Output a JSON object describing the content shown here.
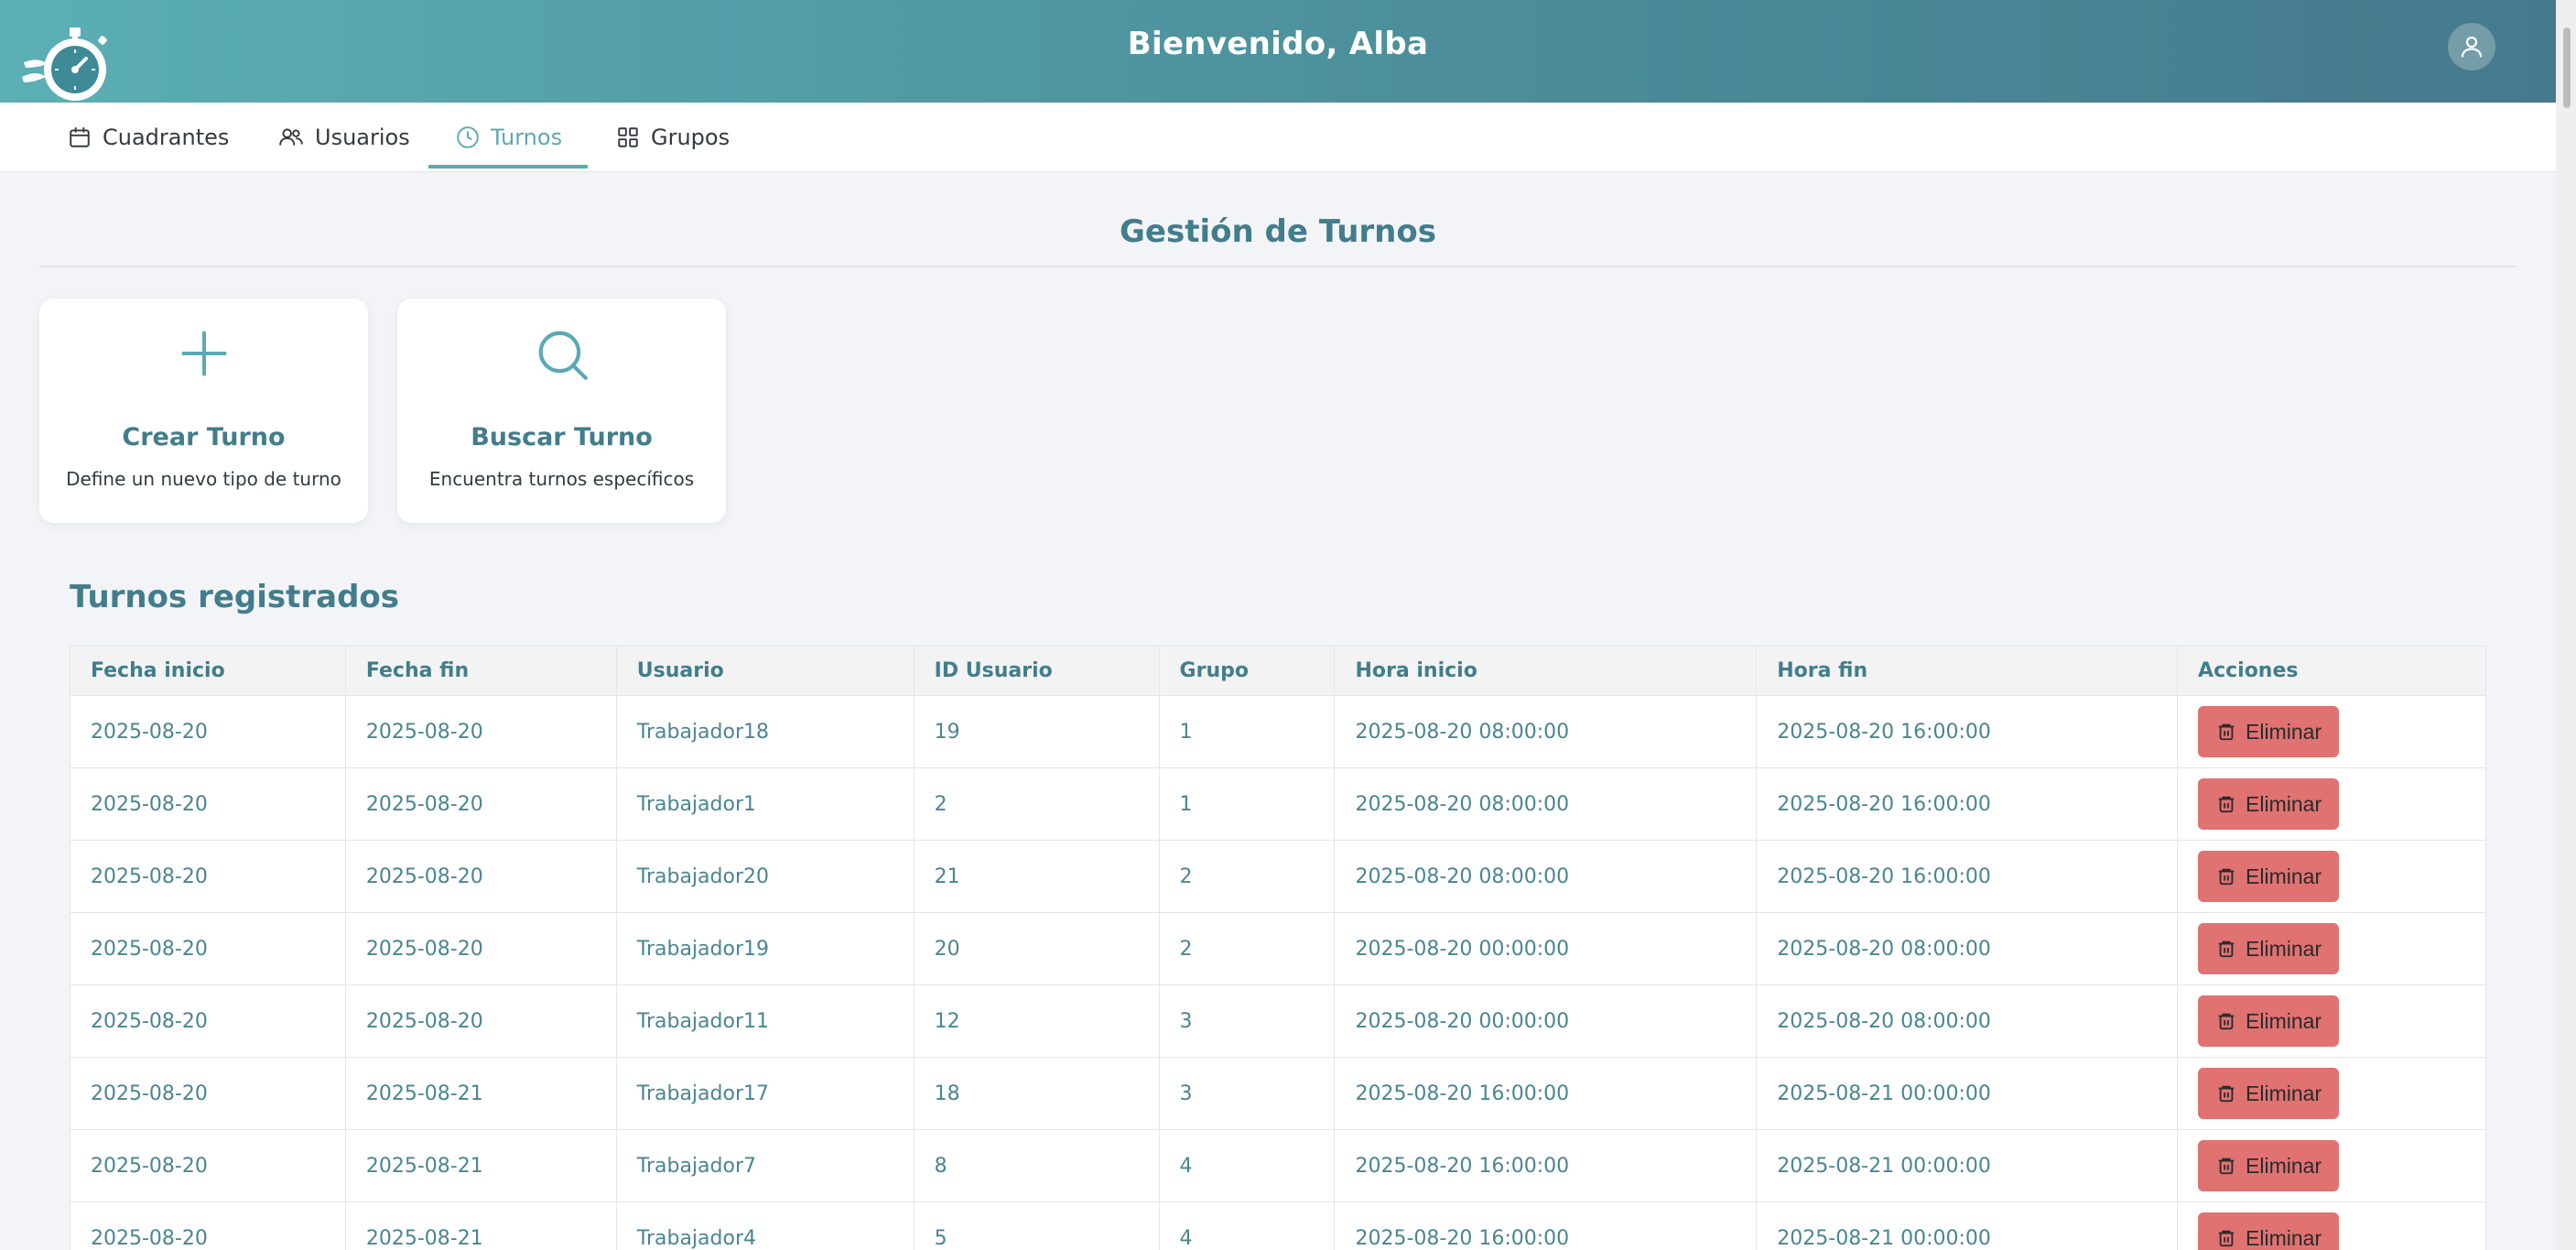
{
  "header": {
    "title": "Bienvenido, Alba",
    "logo_icon": "stopwatch-logo-icon",
    "user_icon": "user-icon"
  },
  "nav": {
    "tabs": [
      {
        "label": "Cuadrantes",
        "icon": "calendar-icon",
        "active": false
      },
      {
        "label": "Usuarios",
        "icon": "users-icon",
        "active": false
      },
      {
        "label": "Turnos",
        "icon": "clock-icon",
        "active": true
      },
      {
        "label": "Grupos",
        "icon": "grid-icon",
        "active": false
      }
    ]
  },
  "page": {
    "title": "Gestión de Turnos"
  },
  "cards": [
    {
      "title": "Crear Turno",
      "description": "Define un nuevo tipo de turno",
      "icon": "plus-icon"
    },
    {
      "title": "Buscar Turno",
      "description": "Encuentra turnos específicos",
      "icon": "search-icon"
    }
  ],
  "table": {
    "section_title": "Turnos registrados",
    "headers": [
      "Fecha inicio",
      "Fecha fin",
      "Usuario",
      "ID Usuario",
      "Grupo",
      "Hora inicio",
      "Hora fin",
      "Acciones"
    ],
    "delete_label": "Eliminar",
    "rows": [
      [
        "2025-08-20",
        "2025-08-20",
        "Trabajador18",
        "19",
        "1",
        "2025-08-20 08:00:00",
        "2025-08-20 16:00:00"
      ],
      [
        "2025-08-20",
        "2025-08-20",
        "Trabajador1",
        "2",
        "1",
        "2025-08-20 08:00:00",
        "2025-08-20 16:00:00"
      ],
      [
        "2025-08-20",
        "2025-08-20",
        "Trabajador20",
        "21",
        "2",
        "2025-08-20 08:00:00",
        "2025-08-20 16:00:00"
      ],
      [
        "2025-08-20",
        "2025-08-20",
        "Trabajador19",
        "20",
        "2",
        "2025-08-20 00:00:00",
        "2025-08-20 08:00:00"
      ],
      [
        "2025-08-20",
        "2025-08-20",
        "Trabajador11",
        "12",
        "3",
        "2025-08-20 00:00:00",
        "2025-08-20 08:00:00"
      ],
      [
        "2025-08-20",
        "2025-08-21",
        "Trabajador17",
        "18",
        "3",
        "2025-08-20 16:00:00",
        "2025-08-21 00:00:00"
      ],
      [
        "2025-08-20",
        "2025-08-21",
        "Trabajador7",
        "8",
        "4",
        "2025-08-20 16:00:00",
        "2025-08-21 00:00:00"
      ],
      [
        "2025-08-20",
        "2025-08-21",
        "Trabajador4",
        "5",
        "4",
        "2025-08-20 16:00:00",
        "2025-08-21 00:00:00"
      ]
    ]
  },
  "colors": {
    "header_gradient_start": "#5bafb5",
    "header_gradient_end": "#457a8c",
    "accent": "#5aa9b4",
    "title_text": "#427d8b",
    "delete_button": "#e07272",
    "background": "#f3f4f8"
  }
}
